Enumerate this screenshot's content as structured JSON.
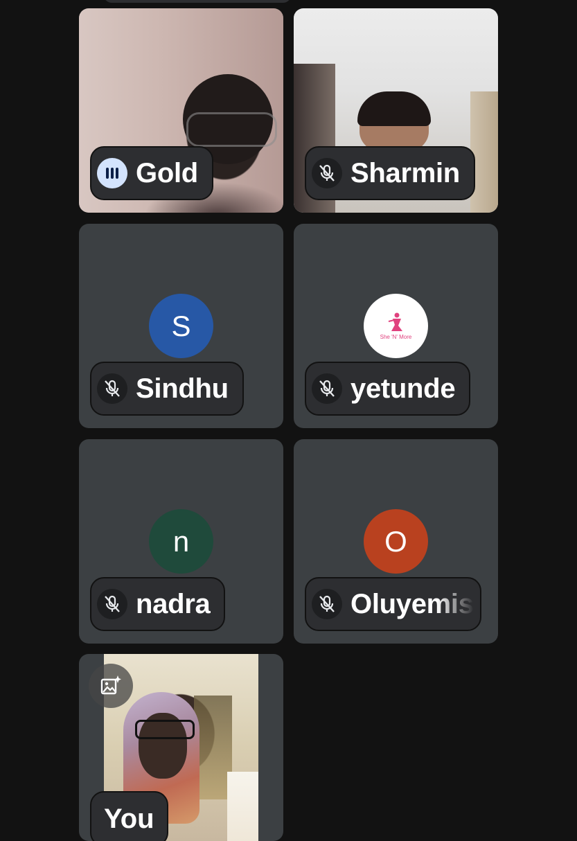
{
  "participants": [
    {
      "name": "Gold",
      "status_icon": "speaking-audio-icon"
    },
    {
      "name": "Sharmin",
      "status_icon": "mic-off-icon"
    },
    {
      "name": "Sindhu",
      "status_icon": "mic-off-icon",
      "avatar_letter": "S",
      "avatar_color": "#2758a6"
    },
    {
      "name": "yetunde",
      "status_icon": "mic-off-icon",
      "avatar_logo_text": "She 'N' More",
      "logo_color": "#e0417e"
    },
    {
      "name": "nadra",
      "status_icon": "mic-off-icon",
      "avatar_letter": "n",
      "avatar_color": "#1f4a3b"
    },
    {
      "name": "Oluyemis",
      "status_icon": "mic-off-icon",
      "avatar_letter": "O",
      "avatar_color": "#b9411f"
    }
  ],
  "self_view": {
    "label": "You",
    "effects_icon": "image-effects-icon"
  },
  "colors": {
    "background": "#121212",
    "tile": "#3c4043",
    "chip": "#2d2e31",
    "speaking": "#d3e3fd"
  }
}
